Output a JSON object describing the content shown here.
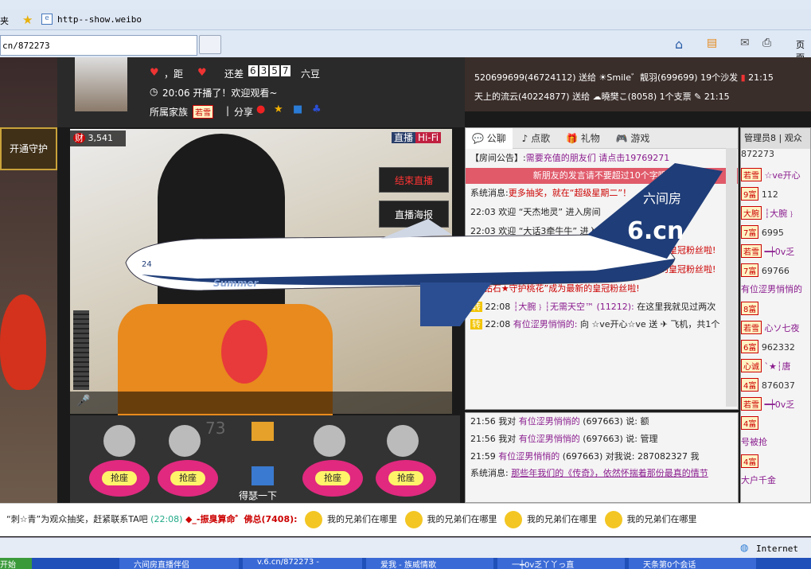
{
  "browser": {
    "menu_left": "夹",
    "favorites_label": "http--show.weibo",
    "address": "cn/872273",
    "page_label": "页面",
    "status_zone": "Internet"
  },
  "host": {
    "rank_text": "，距",
    "behind_label": "还差",
    "digits": [
      "6",
      "3",
      "5",
      "7"
    ],
    "unit": "六豆",
    "time_line": "20:06 开播了！欢迎观看~",
    "family_label": "所属家族",
    "family_badge": "若雪",
    "share_label": "分享"
  },
  "broadcast": {
    "guard_button": "开通守护",
    "wealth": "3,541",
    "live_label": "直播",
    "hifi_label": "Hi-Fi",
    "end_button": "结束直播",
    "poster_button": "直播海报",
    "seat_label": "抢座",
    "center_name": "得瑟一下",
    "seat_number": "73"
  },
  "plane": {
    "brand": "六间房",
    "domain": "6.cn",
    "tail": "24",
    "logo_text": "Summer"
  },
  "gifts_feed": [
    {
      "text": "520699699(46724112) 送给",
      "mid": "Smile゛靓羽",
      "tail": "(699699) 19个沙发",
      "time": "21:15"
    },
    {
      "text": "天上的流云(40224877) 送给",
      "mid": "曉樊こ",
      "tail": "(8058) 1个支票",
      "time": "21:15"
    }
  ],
  "tabs": {
    "chat": "公聊",
    "song": "点歌",
    "gift": "礼物",
    "game": "游戏"
  },
  "chat": {
    "notice_prefix": "【房间公告】:",
    "notice_text": "需要充值的朋友们 请点击19769271",
    "newbie_warning": "新朋友的发言请不要超过10个字哦!",
    "system_label": "系统消息:",
    "system_text": "更多抽奖，就在“超级星期二”！",
    "lines": [
      {
        "time": "22:03",
        "text": "欢迎 “天杰地灵” 进入房间"
      },
      {
        "time": "22:03",
        "text": "欢迎 “大话3牵牛牛” 进入房"
      }
    ],
    "partial_1": "成为最新的皇冠粉丝啦!",
    "partial_2": "“小钻石★守护桃花”成为最新的皇冠粉丝啦!",
    "msg1_time": "22:08",
    "msg1_name": "┆大腕﹜┆无需天空™",
    "msg1_id": "(11212):",
    "msg1_text": "在这里我就见过两次",
    "msg2_time": "22:08",
    "msg2_name": "有位涩男悄悄的:",
    "msg2_text": "向 ☆ve开心☆ve 送",
    "msg2_tail": "飞机，共1个",
    "transfer_label": "转"
  },
  "chat_private": [
    {
      "time": "21:56",
      "prefix": "我对",
      "name": "有位涩男悄悄的",
      "id": "(697663)",
      "text": "说: 额"
    },
    {
      "time": "21:56",
      "prefix": "我对",
      "name": "有位涩男悄悄的",
      "id": "(697663)",
      "text": "说: 管理"
    },
    {
      "time": "21:59",
      "prefix": "",
      "name": "有位涩男悄悄的",
      "id": "(697663)",
      "text": "对我说: 287082327 我"
    }
  ],
  "private_system_label": "系统消息:",
  "private_system_text": "那些年我们的《传奇》，依然怀揣着那份最真的情节",
  "managers": {
    "tab": "管理员8",
    "tab2": "观众",
    "rows": [
      {
        "name": "872273",
        "badge": ""
      },
      {
        "name": "☆ve开心",
        "badge": "若雪"
      },
      {
        "name": "112",
        "badge": "9富"
      },
      {
        "name": "┆大腕﹜",
        "badge": "大腕"
      },
      {
        "name": "6995",
        "badge": "7富"
      },
      {
        "name": "━┿0v乏",
        "badge": "若雪"
      },
      {
        "name": "69766",
        "badge": "7富"
      },
      {
        "name": "有位涩男悄悄的",
        "badge": ""
      },
      {
        "name": "",
        "badge": "8富"
      },
      {
        "name": "心ソ七夜",
        "badge": "若雪"
      },
      {
        "name": "962332",
        "badge": "6富"
      },
      {
        "name": "`★┆唐",
        "badge": "心诚"
      },
      {
        "name": "876037",
        "badge": "4富"
      },
      {
        "name": "━┿0v乏",
        "badge": "若雪"
      },
      {
        "name": "",
        "badge": "4富"
      },
      {
        "name": "号被抢",
        "badge": ""
      },
      {
        "name": "",
        "badge": "4富"
      },
      {
        "name": "大户千金",
        "badge": ""
      }
    ]
  },
  "ticker": {
    "lead": "“刺☆青”为观众抽奖，赶紧联系TA吧",
    "lead_time": "(22:08)",
    "announcer": "◆_-振臭算命゛佛总(7408):",
    "repeat": "我的兄弟们在哪里"
  },
  "taskbar": {
    "start": "开始",
    "items": [
      "六间房直播伴侣",
      "v.6.cn/872273 -",
      "爱我 - 族威情歌",
      "一┿0v乏丫丫っ直",
      "天条第0个会话"
    ]
  },
  "colors": {
    "red": "#cc0000",
    "purple": "#8a1c8e",
    "pink": "#e0297f"
  }
}
